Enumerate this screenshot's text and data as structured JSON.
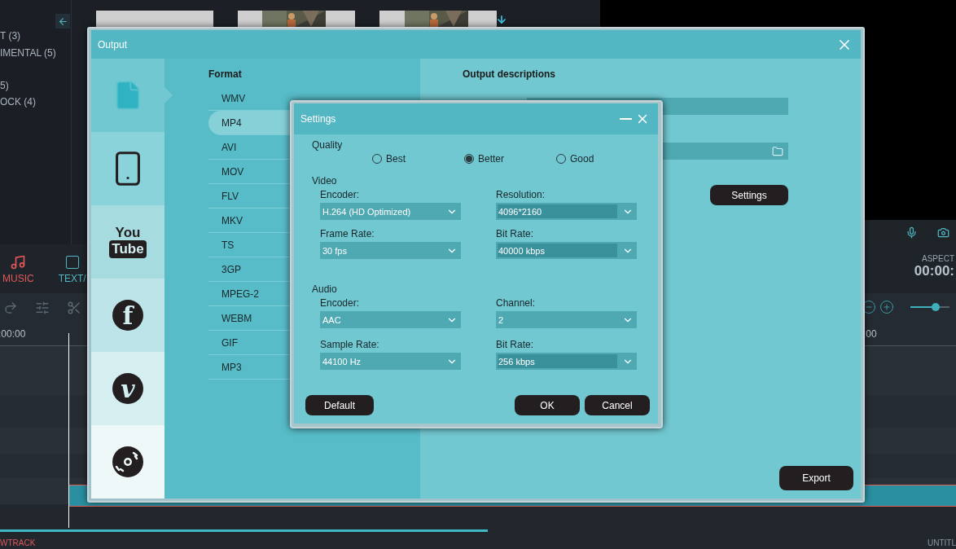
{
  "app": {
    "library": [
      "T (3)",
      "IMENTAL (5)",
      "5)",
      "OCK (4)"
    ],
    "tabs": [
      {
        "label": "MUSIC",
        "selected": true
      },
      {
        "label": "TEXT/",
        "selected": false
      }
    ],
    "aspect_label": "ASPECT",
    "timecode": "00:00:",
    "ruler_left": ":00:00",
    "ruler_right": ":00",
    "zoom_slider": {
      "level": 0.65
    },
    "progress": {
      "level": 0.51
    },
    "bottom_left": "WTRACK",
    "bottom_right": "UNTITL"
  },
  "output": {
    "title": "Output",
    "targets": [
      {
        "kind": "file",
        "selected": true
      },
      {
        "kind": "phone",
        "selected": false
      },
      {
        "kind": "youtube",
        "selected": false,
        "logo_top": "You",
        "logo_bottom": "Tube"
      },
      {
        "kind": "facebook",
        "selected": false,
        "glyph": "f"
      },
      {
        "kind": "vimeo",
        "selected": false,
        "glyph": "v"
      },
      {
        "kind": "disc",
        "selected": false
      }
    ],
    "format_heading": "Format",
    "formats": [
      {
        "label": "WMV",
        "selected": false
      },
      {
        "label": "MP4",
        "selected": true
      },
      {
        "label": "AVI",
        "selected": false
      },
      {
        "label": "MOV",
        "selected": false
      },
      {
        "label": "FLV",
        "selected": false
      },
      {
        "label": "MKV",
        "selected": false
      },
      {
        "label": "TS",
        "selected": false
      },
      {
        "label": "3GP",
        "selected": false
      },
      {
        "label": "MPEG-2",
        "selected": false
      },
      {
        "label": "WEBM",
        "selected": false
      },
      {
        "label": "GIF",
        "selected": false
      },
      {
        "label": "MP3",
        "selected": false
      }
    ],
    "descriptions_heading": "Output descriptions",
    "settings_button": "Settings",
    "export_button": "Export"
  },
  "settings": {
    "title": "Settings",
    "quality_label": "Quality",
    "quality": [
      {
        "label": "Best",
        "selected": false
      },
      {
        "label": "Better",
        "selected": true
      },
      {
        "label": "Good",
        "selected": false
      }
    ],
    "sections": [
      {
        "title": "Video",
        "fields": [
          {
            "label": "Encoder:",
            "value": "H.264 (HD Optimized)",
            "highlighted": false
          },
          {
            "label": "Resolution:",
            "value": "4096*2160",
            "highlighted": true
          },
          {
            "label": "Frame Rate:",
            "value": "30 fps",
            "highlighted": false
          },
          {
            "label": "Bit Rate:",
            "value": "40000 kbps",
            "highlighted": true
          }
        ]
      },
      {
        "title": "Audio",
        "fields": [
          {
            "label": "Encoder:",
            "value": "AAC",
            "highlighted": false
          },
          {
            "label": "Channel:",
            "value": "2",
            "highlighted": false
          },
          {
            "label": "Sample Rate:",
            "value": "44100 Hz",
            "highlighted": false
          },
          {
            "label": "Bit Rate:",
            "value": "256 kbps",
            "highlighted": true
          }
        ]
      }
    ],
    "buttons": [
      "Default",
      "OK",
      "Cancel"
    ]
  }
}
